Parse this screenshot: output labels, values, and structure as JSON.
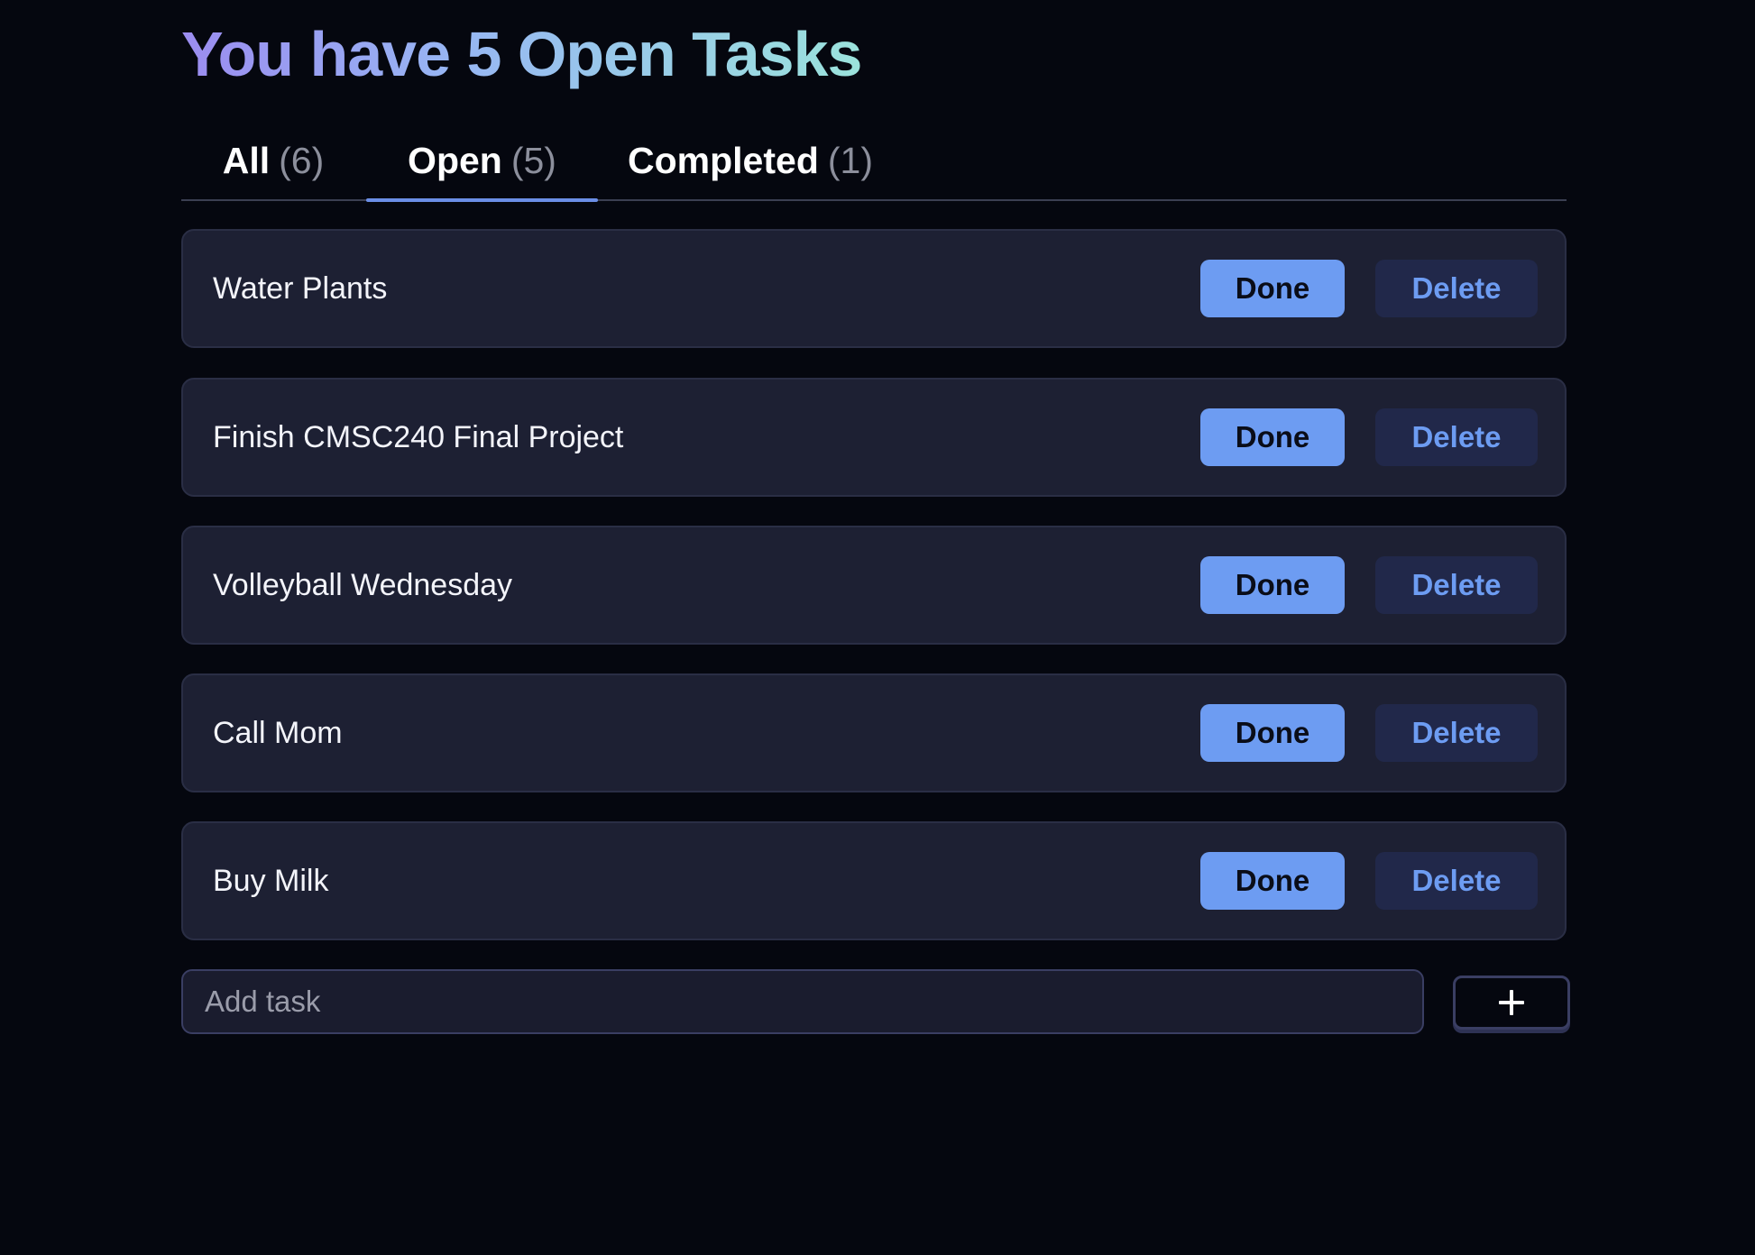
{
  "header": {
    "title": "You have 5 Open Tasks"
  },
  "tabs": [
    {
      "label": "All",
      "count": "(6)",
      "active": false
    },
    {
      "label": "Open",
      "count": "(5)",
      "active": true
    },
    {
      "label": "Completed",
      "count": "(1)",
      "active": false
    }
  ],
  "tasks": [
    {
      "label": "Water Plants",
      "done_label": "Done",
      "delete_label": "Delete"
    },
    {
      "label": "Finish CMSC240 Final Project",
      "done_label": "Done",
      "delete_label": "Delete"
    },
    {
      "label": "Volleyball Wednesday",
      "done_label": "Done",
      "delete_label": "Delete"
    },
    {
      "label": "Call Mom",
      "done_label": "Done",
      "delete_label": "Delete"
    },
    {
      "label": "Buy Milk",
      "done_label": "Done",
      "delete_label": "Delete"
    }
  ],
  "add_task": {
    "placeholder": "Add task",
    "value": "",
    "button_icon": "plus-icon"
  },
  "colors": {
    "background": "#05070f",
    "card": "#1d2033",
    "accent": "#6d9cf2",
    "delete_bg": "#21284a",
    "tab_underline": "#6b8ee6",
    "title_gradient_start": "#9b8cf0",
    "title_gradient_end": "#9be3dc"
  }
}
